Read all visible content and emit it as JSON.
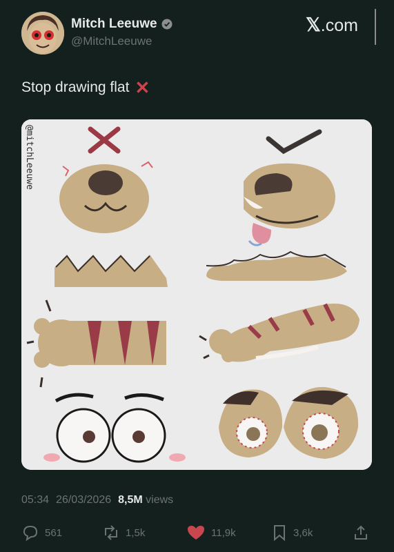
{
  "author": {
    "display_name": "Mitch Leeuwe",
    "handle": "@MitchLeeuwe",
    "verified_icon": "verified-badge-icon"
  },
  "brand": {
    "x": "𝕏",
    "domain": ".com"
  },
  "tweet": {
    "text": "Stop drawing flat",
    "emoji": "✕",
    "emoji_color": "#c8464f"
  },
  "media": {
    "watermark": "@mitchLeeuwe"
  },
  "meta": {
    "time": "05:34",
    "date": "26/03/2026",
    "views_count": "8,5M",
    "views_label": "views"
  },
  "actions": {
    "replies": "561",
    "reposts": "1,5k",
    "likes": "11,9k",
    "bookmarks": "3,6k"
  },
  "colors": {
    "background": "#13201d",
    "like_accent": "#c8464f",
    "skin": "#c7ae85",
    "stripe": "#9a3c48"
  }
}
